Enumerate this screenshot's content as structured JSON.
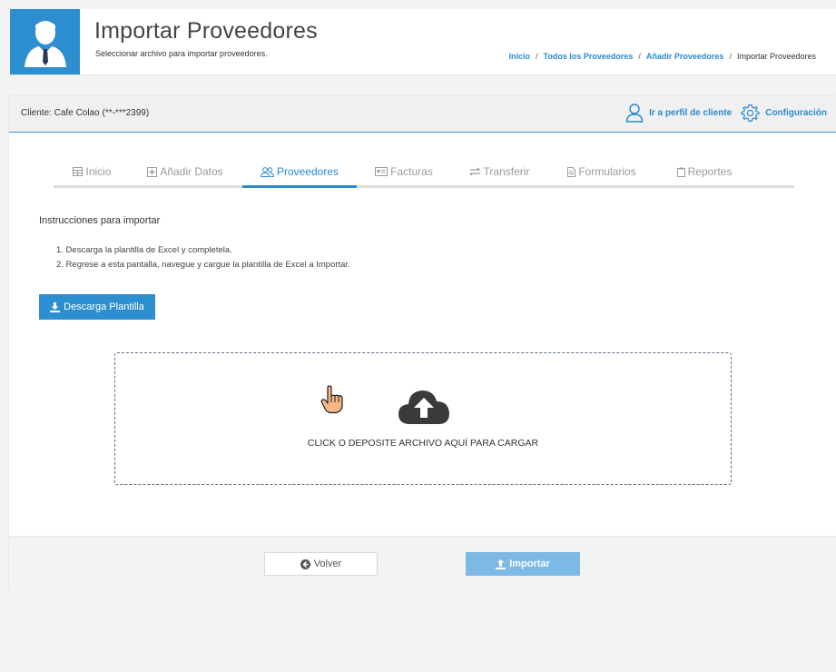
{
  "header": {
    "title": "Importar Proveedores",
    "subtitle": "Seleccionar archivo para importar proveedores.",
    "breadcrumb": [
      {
        "label": "Inicio"
      },
      {
        "label": "Todos los Proveedores"
      },
      {
        "label": "Añadir Proveedores"
      },
      {
        "label": "Importar Proveedores"
      }
    ]
  },
  "client_bar": {
    "client_label": "Cliente: Cafe Colao (**-***2399)",
    "profile_link": "Ir a perfil de cliente",
    "config_link": "Configuración"
  },
  "tabs": [
    {
      "label": "Inicio",
      "icon": "table-icon"
    },
    {
      "label": "Añadir Datos",
      "icon": "plus-square-icon"
    },
    {
      "label": "Proveedores",
      "icon": "users-icon",
      "active": true
    },
    {
      "label": "Facturas",
      "icon": "invoice-icon"
    },
    {
      "label": "Transferir",
      "icon": "transfer-icon"
    },
    {
      "label": "Formularios",
      "icon": "file-icon"
    },
    {
      "label": "Reportes",
      "icon": "clipboard-icon"
    }
  ],
  "instructions": {
    "title": "Instrucciones para importar",
    "steps": [
      "1. Descarga la plantilla de Excel y completela.",
      "2. Regrese a esta pantalla, navegue y cargue la plantilla de Excel a Importar."
    ]
  },
  "download_button": "Descarga Plantilla",
  "dropzone": {
    "text": "CLICK O DEPOSITE ARCHIVO AQUÍ PARA CARGAR"
  },
  "footer": {
    "back_label": "Volver",
    "import_label": "Importar"
  },
  "colors": {
    "primary": "#2e8fd0",
    "import_disabled": "#7cb9e4",
    "link": "#2a8ad0"
  }
}
